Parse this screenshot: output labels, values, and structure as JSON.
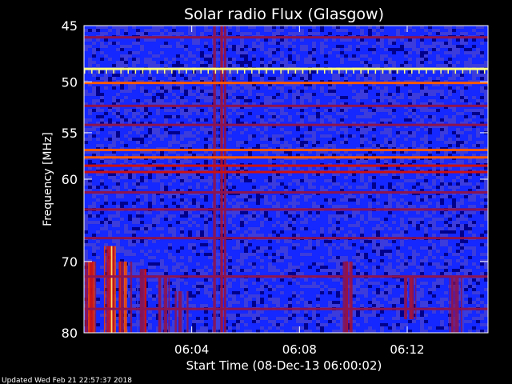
{
  "chart_data": {
    "type": "heatmap",
    "title": "Solar radio Flux (Glasgow)",
    "xlabel": "Start Time (08-Dec-13 06:00:02)",
    "ylabel": "Frequency [MHz]",
    "footer": "Updated Wed Feb 21 22:57:37 2018",
    "x_range_minutes": [
      0,
      15
    ],
    "x_ticks": [
      {
        "minute": 4,
        "label": "06:04"
      },
      {
        "minute": 8,
        "label": "06:08"
      },
      {
        "minute": 12,
        "label": "06:12"
      }
    ],
    "y_range_mhz": [
      45,
      80
    ],
    "y_scale": "log",
    "y_ticks": [
      {
        "mhz": 45,
        "label": "45"
      },
      {
        "mhz": 50,
        "label": "50"
      },
      {
        "mhz": 55,
        "label": "55"
      },
      {
        "mhz": 60,
        "label": "60"
      },
      {
        "mhz": 70,
        "label": "70"
      },
      {
        "mhz": 80,
        "label": "80"
      }
    ],
    "colormap": [
      "#00008c",
      "#1428ff",
      "#3c3cdc",
      "#8c1450",
      "#cc1010",
      "#ff5a00",
      "#ffff80"
    ],
    "steady_bands_mhz": [
      {
        "mhz": 48.8,
        "level": 1.0
      },
      {
        "mhz": 50.1,
        "level": 0.8
      },
      {
        "mhz": 56.8,
        "level": 0.75
      },
      {
        "mhz": 57.6,
        "level": 0.8
      },
      {
        "mhz": 58.5,
        "level": 0.7
      },
      {
        "mhz": 59.2,
        "level": 0.6
      },
      {
        "mhz": 46.0,
        "level": 0.5
      },
      {
        "mhz": 52.3,
        "level": 0.45
      },
      {
        "mhz": 54.2,
        "level": 0.45
      },
      {
        "mhz": 61.5,
        "level": 0.42
      },
      {
        "mhz": 63.5,
        "level": 0.42
      },
      {
        "mhz": 67.0,
        "level": 0.45
      },
      {
        "mhz": 72.0,
        "level": 0.5
      },
      {
        "mhz": 76.5,
        "level": 0.45
      }
    ],
    "bursts": [
      {
        "minute": 0.2,
        "mhz_from": 70,
        "mhz_to": 80,
        "level": 0.85
      },
      {
        "minute": 0.9,
        "mhz_from": 68,
        "mhz_to": 80,
        "level": 0.95
      },
      {
        "minute": 1.5,
        "mhz_from": 70,
        "mhz_to": 80,
        "level": 0.8
      },
      {
        "minute": 2.2,
        "mhz_from": 71,
        "mhz_to": 80,
        "level": 0.65
      },
      {
        "minute": 2.9,
        "mhz_from": 72,
        "mhz_to": 80,
        "level": 0.6
      },
      {
        "minute": 3.6,
        "mhz_from": 74,
        "mhz_to": 80,
        "level": 0.55
      },
      {
        "minute": 5.0,
        "mhz_from": 45,
        "mhz_to": 80,
        "level": 0.7
      },
      {
        "minute": 9.8,
        "mhz_from": 70,
        "mhz_to": 80,
        "level": 0.7
      },
      {
        "minute": 12.1,
        "mhz_from": 72,
        "mhz_to": 78,
        "level": 0.7
      },
      {
        "minute": 13.8,
        "mhz_from": 72,
        "mhz_to": 80,
        "level": 0.65
      }
    ]
  }
}
